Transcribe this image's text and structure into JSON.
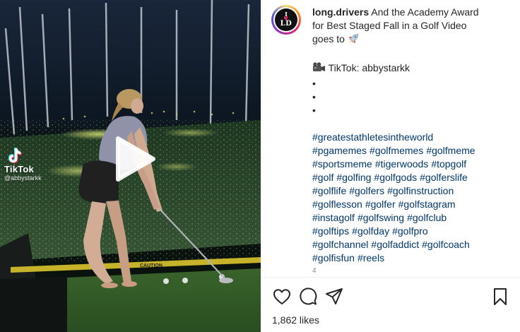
{
  "video": {
    "watermark_brand": "TikTok",
    "watermark_handle": "@abbystarkk",
    "floor_sign": "CAUTION"
  },
  "post": {
    "username": "long.drivers",
    "caption_lines": [
      "And the Academy Award",
      "for Best Staged Fall in a Golf Video",
      "goes to"
    ],
    "rocket_emoji": "🚀",
    "camera_emoji": "📹",
    "credit": "TikTok: abbystarkk",
    "bullets": [
      "•",
      "•",
      "•"
    ],
    "hashtag_lines": [
      [
        "#greatestathletesintheworld"
      ],
      [
        "#pgamemes",
        "#golfmemes",
        "#golfmeme"
      ],
      [
        "#sportsmeme",
        "#tigerwoods",
        "#topgolf"
      ],
      [
        "#golf",
        "#golfing",
        "#golfgods",
        "#golferslife"
      ],
      [
        "#golflife",
        "#golfers",
        "#golfinstruction"
      ],
      [
        "#golflesson",
        "#golfer",
        "#golfstagram"
      ],
      [
        "#instagolf",
        "#golfswing",
        "#golfclub"
      ],
      [
        "#golftips",
        "#golfday",
        "#golfpro"
      ],
      [
        "#golfchannel",
        "#golfaddict",
        "#golfcoach"
      ],
      [
        "#golfisfun",
        "#reels"
      ]
    ],
    "truncated_text": "4"
  },
  "actions": {
    "likes": "1,862 likes"
  },
  "avatar": {
    "top": "I",
    "bottom": "LD"
  },
  "colors": {
    "hashtag": "#00376b",
    "text": "#262626",
    "divider": "#efefef",
    "muted": "#8e8e8e"
  },
  "icons": [
    "heart-icon",
    "comment-icon",
    "share-icon",
    "bookmark-icon",
    "play-icon",
    "tiktok-logo-icon",
    "rocket-emoji",
    "camera-emoji"
  ]
}
